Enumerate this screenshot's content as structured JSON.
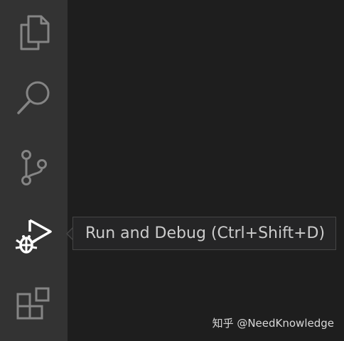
{
  "activity_bar": {
    "items": [
      {
        "id": "explorer",
        "icon": "files-icon",
        "active": false
      },
      {
        "id": "search",
        "icon": "search-icon",
        "active": false
      },
      {
        "id": "source-control",
        "icon": "source-control-icon",
        "active": false
      },
      {
        "id": "run-and-debug",
        "icon": "run-debug-icon",
        "active": true
      },
      {
        "id": "extensions",
        "icon": "extensions-icon",
        "active": false
      }
    ],
    "colors": {
      "background": "#333333",
      "icon_inactive": "#858585",
      "icon_active": "#ffffff"
    }
  },
  "tooltip": {
    "text": "Run and Debug (Ctrl+Shift+D)"
  },
  "watermark": {
    "text": "知乎 @NeedKnowledge"
  },
  "editor": {
    "background": "#1e1e1e"
  }
}
